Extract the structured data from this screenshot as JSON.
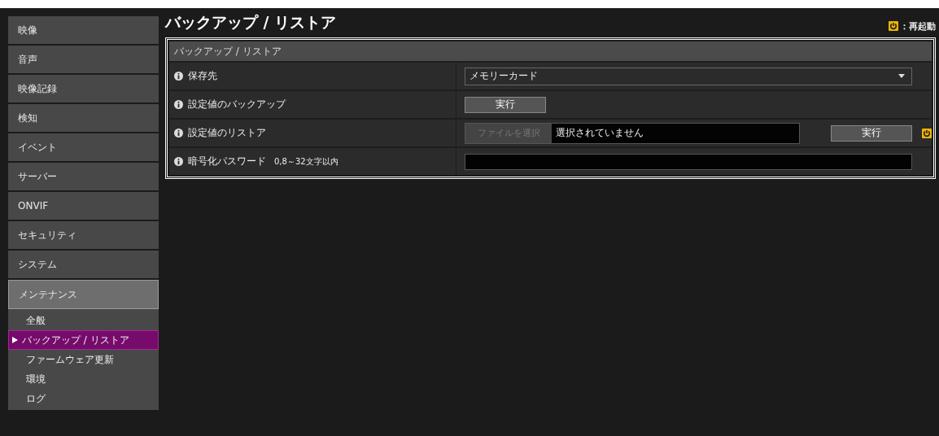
{
  "sidebar": {
    "items": [
      {
        "label": "映像",
        "expanded": false
      },
      {
        "label": "音声",
        "expanded": false
      },
      {
        "label": "映像記録",
        "expanded": false
      },
      {
        "label": "検知",
        "expanded": false
      },
      {
        "label": "イベント",
        "expanded": false
      },
      {
        "label": "サーバー",
        "expanded": false
      },
      {
        "label": "ONVIF",
        "expanded": false
      },
      {
        "label": "セキュリティ",
        "expanded": false
      },
      {
        "label": "システム",
        "expanded": false
      },
      {
        "label": "メンテナンス",
        "expanded": true,
        "children": [
          {
            "label": "全般",
            "selected": false
          },
          {
            "label": "バックアップ / リストア",
            "selected": true
          },
          {
            "label": "ファームウェア更新",
            "selected": false
          },
          {
            "label": "環境",
            "selected": false
          },
          {
            "label": "ログ",
            "selected": false
          }
        ]
      }
    ]
  },
  "page": {
    "title": "バックアップ / リストア",
    "legend": "：再起動"
  },
  "panel": {
    "title": "バックアップ / リストア",
    "rows": [
      {
        "kind": "select",
        "label": "保存先",
        "value": "メモリーカード"
      },
      {
        "kind": "button",
        "label": "設定値のバックアップ",
        "button": "実行"
      },
      {
        "kind": "file",
        "label": "設定値のリストア",
        "file_button": "ファイルを選択",
        "file_status": "選択されていません",
        "button": "実行",
        "restart": true
      },
      {
        "kind": "password",
        "label": "暗号化パスワード",
        "hint": "0,8～32文字以内"
      }
    ]
  }
}
